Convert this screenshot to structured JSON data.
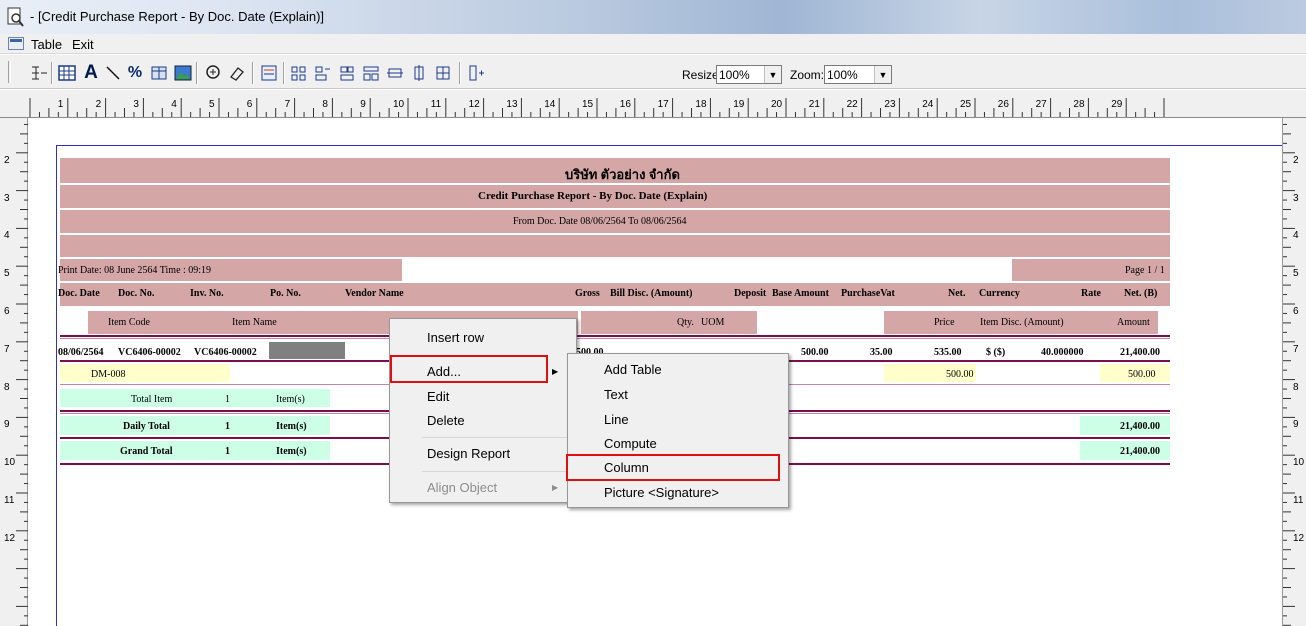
{
  "window": {
    "title": "- [Credit Purchase Report - By Doc. Date (Explain)]"
  },
  "menubar": {
    "items": [
      "Table",
      "Exit"
    ]
  },
  "toolbar": {
    "resize_label": "Resize:",
    "resize_value": "100%",
    "zoom_label": "Zoom:",
    "zoom_value": "100%"
  },
  "ruler": {
    "h": [
      "1",
      "2",
      "3",
      "4",
      "5",
      "6",
      "7",
      "8",
      "9",
      "10",
      "11",
      "12",
      "13",
      "14",
      "15",
      "16",
      "17",
      "18",
      "19",
      "20",
      "21",
      "22",
      "23",
      "24",
      "25",
      "26",
      "27",
      "28",
      "29"
    ],
    "v": [
      "2",
      "3",
      "4",
      "5",
      "6",
      "7",
      "8",
      "9",
      "10",
      "11",
      "12"
    ]
  },
  "report": {
    "company": "บริษัท ตัวอย่าง จำกัด",
    "title": "Credit Purchase Report - By Doc. Date (Explain)",
    "range": "From Doc. Date 08/06/2564 To 08/06/2564",
    "print_date": "Print Date: 08 June 2564  Time : 09:19",
    "page": "Page 1 / 1",
    "headers1": [
      "Doc. Date",
      "Doc. No.",
      "Inv. No.",
      "Po. No.",
      "Vendor Name",
      "Gross",
      "Bill Disc. (Amount)",
      "Deposit",
      "Base Amount",
      "PurchaseVat",
      "Net.",
      "Currency",
      "Rate",
      "Net. (B)"
    ],
    "headers2": [
      "Item Code",
      "Item Name",
      "Qty.",
      "UOM",
      "Price",
      "Item Disc. (Amount)",
      "Amount"
    ],
    "row": {
      "doc_date": "08/06/2564",
      "doc_no": "VC6406-00002",
      "inv_no": "VC6406-00002",
      "gross": "500.00",
      "base_amount": "500.00",
      "vat": "35.00",
      "net": "535.00",
      "currency": "$ ($)",
      "rate": "40.000000",
      "net_b": "21,400.00"
    },
    "item": {
      "code": "DM-008",
      "price": "500.00",
      "amount": "500.00"
    },
    "total_item": {
      "label": "Total Item",
      "count": "1",
      "unit": "Item(s)"
    },
    "daily_total": {
      "label": "Daily Total",
      "count": "1",
      "unit": "Item(s)",
      "amount": "21,400.00"
    },
    "grand_total": {
      "label": "Grand Total",
      "count": "1",
      "unit": "Item(s)",
      "amount": "21,400.00"
    }
  },
  "context_menu": {
    "items": [
      "Insert row",
      "Add...",
      "Edit",
      "Delete",
      "Design Report",
      "Align Object"
    ],
    "highlighted": "Add...",
    "disabled": [
      "Align Object"
    ]
  },
  "submenu": {
    "items": [
      "Add Table",
      "Text",
      "Line",
      "Compute",
      "Column",
      "Picture <Signature>"
    ],
    "highlighted": "Column"
  },
  "colors": {
    "band": "#d5a6a6",
    "highlight_box": "#e01010",
    "total_bg": "#ccffe6",
    "item_bg": "#ffffcc"
  }
}
